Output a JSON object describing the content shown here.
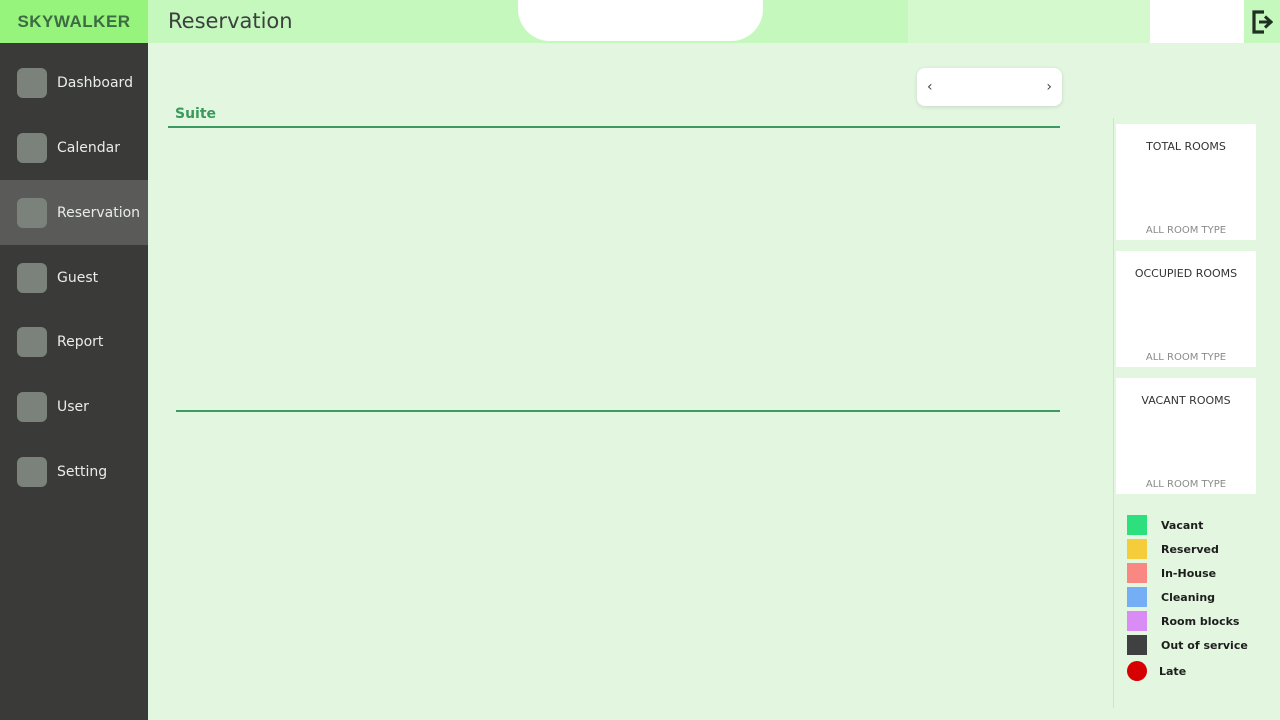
{
  "app": {
    "brand": "SKYWALKER"
  },
  "header": {
    "title": "Reservation",
    "logout_icon": "logout-icon"
  },
  "sidebar": {
    "items": [
      {
        "label": "Dashboard"
      },
      {
        "label": "Calendar"
      },
      {
        "label": "Reservation",
        "active": true
      },
      {
        "label": "Guest"
      },
      {
        "label": "Report"
      },
      {
        "label": "User"
      },
      {
        "label": "Setting"
      }
    ]
  },
  "date_nav": {
    "prev": "‹",
    "next": "›"
  },
  "section": {
    "title": "Suite"
  },
  "stats": [
    {
      "title": "TOTAL ROOMS",
      "subtitle": "ALL ROOM TYPE"
    },
    {
      "title": "OCCUPIED ROOMS",
      "subtitle": "ALL ROOM TYPE"
    },
    {
      "title": "VACANT ROOMS",
      "subtitle": "ALL ROOM TYPE"
    }
  ],
  "legend": [
    {
      "label": "Vacant",
      "color": "#2de07e"
    },
    {
      "label": "Reserved",
      "color": "#f5cd3b"
    },
    {
      "label": "In-House",
      "color": "#fa8882"
    },
    {
      "label": "Cleaning",
      "color": "#74aef5"
    },
    {
      "label": "Room blocks",
      "color": "#d98cf5"
    },
    {
      "label": "Out of service",
      "color": "#3f4140"
    },
    {
      "label": "Late",
      "color": "#d60000",
      "shape": "circle"
    }
  ],
  "colors": {
    "accent": "#3d9b62",
    "brand_bg": "#96f37b",
    "header_bg": "#c4f8bd",
    "sidebar_bg": "#3a3b39",
    "content_bg": "#e2f6e0"
  }
}
